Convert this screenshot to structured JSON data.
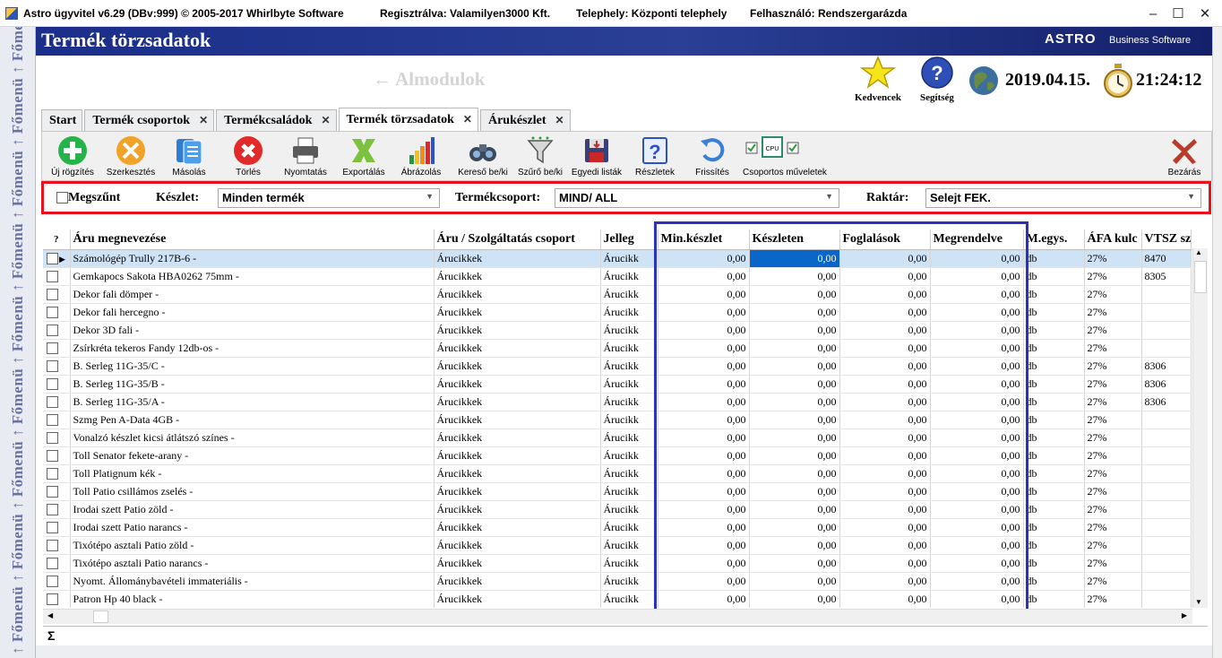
{
  "titlebar": {
    "title": "Astro ügyvitel v6.29 (DBv:999)  © 2005-2017 Whirlbyte Software",
    "reg": "Regisztrálva: Valamilyen3000 Kft.",
    "site": "Telephely: Központi telephely",
    "user": "Felhasználó: Rendszergarázda",
    "minimize": "–",
    "maximize": "☐",
    "close": "✕"
  },
  "sidebar": {
    "label": "↑ Főmenü ↑ Főmenü ↑ Főmenü ↑ Főmenü ↑ Főmenü ↑ Főmenü ↑ Főmenü ↑ Főmenü ↑ Főmenü ↑ Főmenü"
  },
  "header": {
    "title": "Termék törzsadatok",
    "brand": "ASTRO",
    "brand_sub": "Business Software",
    "almodulok": "← Almodulok"
  },
  "top": {
    "favorites": "Kedvencek",
    "help": "Segítség",
    "date": "2019.04.15.",
    "time": "21:24:12"
  },
  "tabs": [
    {
      "label": "Start",
      "close": ""
    },
    {
      "label": "Termék csoportok",
      "close": "✕"
    },
    {
      "label": "Termékcsaládok",
      "close": "✕"
    },
    {
      "label": "Termék törzsadatok",
      "close": "✕"
    },
    {
      "label": "Árukészlet",
      "close": "✕"
    }
  ],
  "toolbar": {
    "new": "Új rögzítés",
    "edit": "Szerkesztés",
    "copy": "Másolás",
    "delete": "Törlés",
    "print": "Nyomtatás",
    "export": "Exportálás",
    "chart": "Ábrázolás",
    "search": "Kereső be/ki",
    "filter": "Szűrő be/ki",
    "lists": "Egyedi listák",
    "details": "Részletek",
    "refresh": "Frissítés",
    "group": "Csoportos műveletek",
    "close": "Bezárás"
  },
  "filters": {
    "discontinued": "Megszűnt",
    "stock_label": "Készlet:",
    "stock_value": "Minden termék",
    "group_label": "Termékcsoport:",
    "group_value": "MIND/ ALL",
    "warehouse_label": "Raktár:",
    "warehouse_value": "Selejt FEK."
  },
  "grid": {
    "columns": [
      "?",
      "Áru megnevezése",
      "Áru / Szolgáltatás csoport",
      "Jelleg",
      "Min.készlet",
      "Készleten",
      "Foglalások",
      "Megrendelve",
      "M.egys.",
      "ÁFA kulc",
      "VTSZ sz"
    ],
    "rows": [
      [
        "Számológép Trully 217B-6 -",
        "Árucikkek",
        "Árucikk",
        "0,00",
        "0,00",
        "0,00",
        "0,00",
        "db",
        "27%",
        "8470"
      ],
      [
        "Gemkapocs Sakota HBA0262 75mm -",
        "Árucikkek",
        "Árucikk",
        "0,00",
        "0,00",
        "0,00",
        "0,00",
        "db",
        "27%",
        "8305"
      ],
      [
        "Dekor fali dömper -",
        "Árucikkek",
        "Árucikk",
        "0,00",
        "0,00",
        "0,00",
        "0,00",
        "db",
        "27%",
        ""
      ],
      [
        "Dekor fali hercegno -",
        "Árucikkek",
        "Árucikk",
        "0,00",
        "0,00",
        "0,00",
        "0,00",
        "db",
        "27%",
        ""
      ],
      [
        "Dekor 3D fali -",
        "Árucikkek",
        "Árucikk",
        "0,00",
        "0,00",
        "0,00",
        "0,00",
        "db",
        "27%",
        ""
      ],
      [
        "Zsírkréta tekeros Fandy 12db-os -",
        "Árucikkek",
        "Árucikk",
        "0,00",
        "0,00",
        "0,00",
        "0,00",
        "db",
        "27%",
        ""
      ],
      [
        "B. Serleg 11G-35/C -",
        "Árucikkek",
        "Árucikk",
        "0,00",
        "0,00",
        "0,00",
        "0,00",
        "db",
        "27%",
        "8306"
      ],
      [
        "B. Serleg 11G-35/B -",
        "Árucikkek",
        "Árucikk",
        "0,00",
        "0,00",
        "0,00",
        "0,00",
        "db",
        "27%",
        "8306"
      ],
      [
        "B. Serleg 11G-35/A -",
        "Árucikkek",
        "Árucikk",
        "0,00",
        "0,00",
        "0,00",
        "0,00",
        "db",
        "27%",
        "8306"
      ],
      [
        "Szmg Pen A-Data 4GB -",
        "Árucikkek",
        "Árucikk",
        "0,00",
        "0,00",
        "0,00",
        "0,00",
        "db",
        "27%",
        ""
      ],
      [
        "Vonalzó készlet kicsi átlátszó színes -",
        "Árucikkek",
        "Árucikk",
        "0,00",
        "0,00",
        "0,00",
        "0,00",
        "db",
        "27%",
        ""
      ],
      [
        "Toll Senator fekete-arany -",
        "Árucikkek",
        "Árucikk",
        "0,00",
        "0,00",
        "0,00",
        "0,00",
        "db",
        "27%",
        ""
      ],
      [
        "Toll Platignum kék -",
        "Árucikkek",
        "Árucikk",
        "0,00",
        "0,00",
        "0,00",
        "0,00",
        "db",
        "27%",
        ""
      ],
      [
        "Toll Patio csillámos zselés -",
        "Árucikkek",
        "Árucikk",
        "0,00",
        "0,00",
        "0,00",
        "0,00",
        "db",
        "27%",
        ""
      ],
      [
        "Irodai szett Patio zöld -",
        "Árucikkek",
        "Árucikk",
        "0,00",
        "0,00",
        "0,00",
        "0,00",
        "db",
        "27%",
        ""
      ],
      [
        "Irodai szett Patio narancs -",
        "Árucikkek",
        "Árucikk",
        "0,00",
        "0,00",
        "0,00",
        "0,00",
        "db",
        "27%",
        ""
      ],
      [
        "Tixótépo asztali Patio zöld -",
        "Árucikkek",
        "Árucikk",
        "0,00",
        "0,00",
        "0,00",
        "0,00",
        "db",
        "27%",
        ""
      ],
      [
        "Tixótépo asztali Patio narancs -",
        "Árucikkek",
        "Árucikk",
        "0,00",
        "0,00",
        "0,00",
        "0,00",
        "db",
        "27%",
        ""
      ],
      [
        "Nyomt. Állománybavételi immateriális -",
        "Árucikkek",
        "Árucikk",
        "0,00",
        "0,00",
        "0,00",
        "0,00",
        "db",
        "27%",
        ""
      ],
      [
        "Patron Hp 40 black -",
        "Árucikkek",
        "Árucikk",
        "0,00",
        "0,00",
        "0,00",
        "0,00",
        "db",
        "27%",
        ""
      ]
    ],
    "sum_symbol": "Σ"
  }
}
